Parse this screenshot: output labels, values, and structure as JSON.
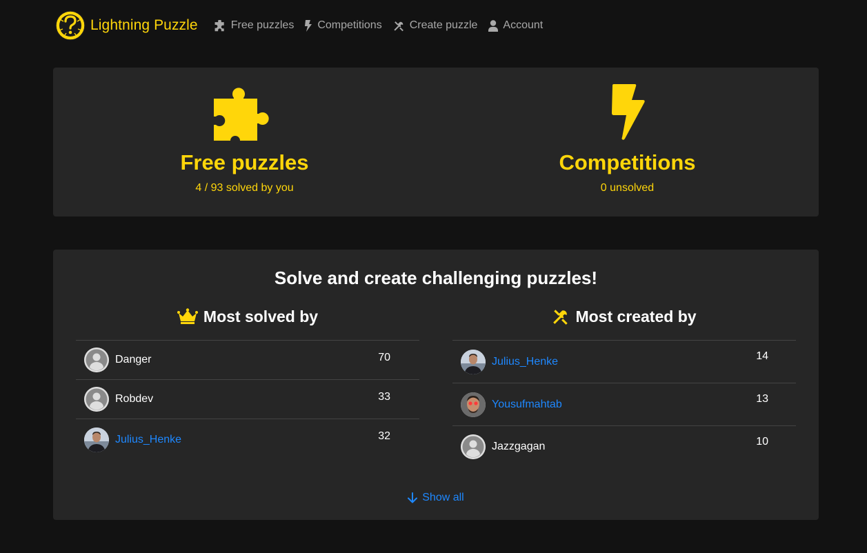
{
  "brand": {
    "name": "Lightning Puzzle"
  },
  "nav": {
    "items": [
      {
        "label": "Free puzzles",
        "icon": "puzzle-icon"
      },
      {
        "label": "Competitions",
        "icon": "bolt-icon"
      },
      {
        "label": "Create puzzle",
        "icon": "tools-icon"
      },
      {
        "label": "Account",
        "icon": "user-icon"
      }
    ]
  },
  "features": {
    "free": {
      "title": "Free puzzles",
      "subtitle": "4 / 93 solved by you",
      "icon": "puzzle-icon"
    },
    "competitions": {
      "title": "Competitions",
      "subtitle": "0 unsolved",
      "icon": "bolt-icon"
    }
  },
  "leaderboard": {
    "title": "Solve and create challenging puzzles!",
    "most_solved": {
      "heading": "Most solved by",
      "icon": "crown-icon",
      "rows": [
        {
          "name": "Danger",
          "count": "70",
          "avatar": "default",
          "link": false
        },
        {
          "name": "Robdev",
          "count": "33",
          "avatar": "default",
          "link": false
        },
        {
          "name": "Julius_Henke",
          "count": "32",
          "avatar": "photo",
          "link": true
        }
      ]
    },
    "most_created": {
      "heading": "Most created by",
      "icon": "tools-icon",
      "rows": [
        {
          "name": "Julius_Henke",
          "count": "14",
          "avatar": "photo",
          "link": true
        },
        {
          "name": "Yousufmahtab",
          "count": "13",
          "avatar": "photo",
          "link": true
        },
        {
          "name": "Jazzgagan",
          "count": "10",
          "avatar": "default",
          "link": false
        }
      ]
    },
    "show_all": "Show all"
  },
  "colors": {
    "accent": "#ffd60a",
    "link": "#1e88ff",
    "card": "#262626",
    "background": "#121212"
  }
}
